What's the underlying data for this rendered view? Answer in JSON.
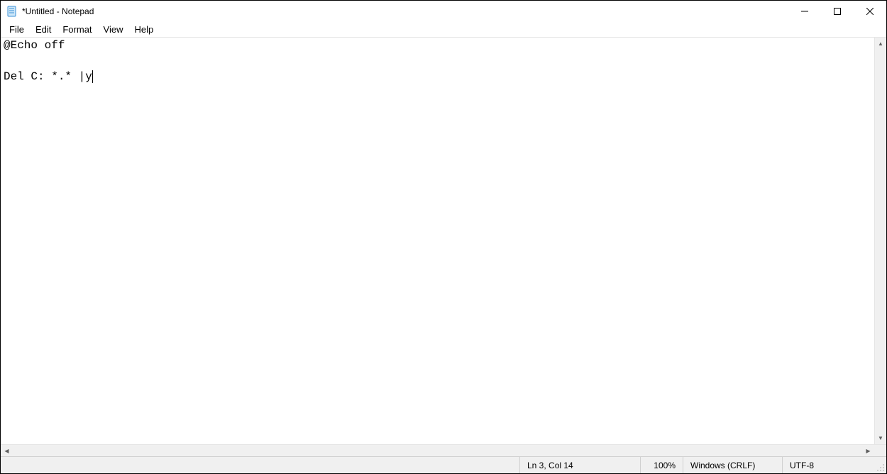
{
  "title": "*Untitled - Notepad",
  "menu": {
    "file": "File",
    "edit": "Edit",
    "format": "Format",
    "view": "View",
    "help": "Help"
  },
  "editor": {
    "content": "@Echo off\n\nDel C: *.* |y"
  },
  "status": {
    "position": "Ln 3, Col 14",
    "zoom": "100%",
    "line_ending": "Windows (CRLF)",
    "encoding": "UTF-8"
  }
}
